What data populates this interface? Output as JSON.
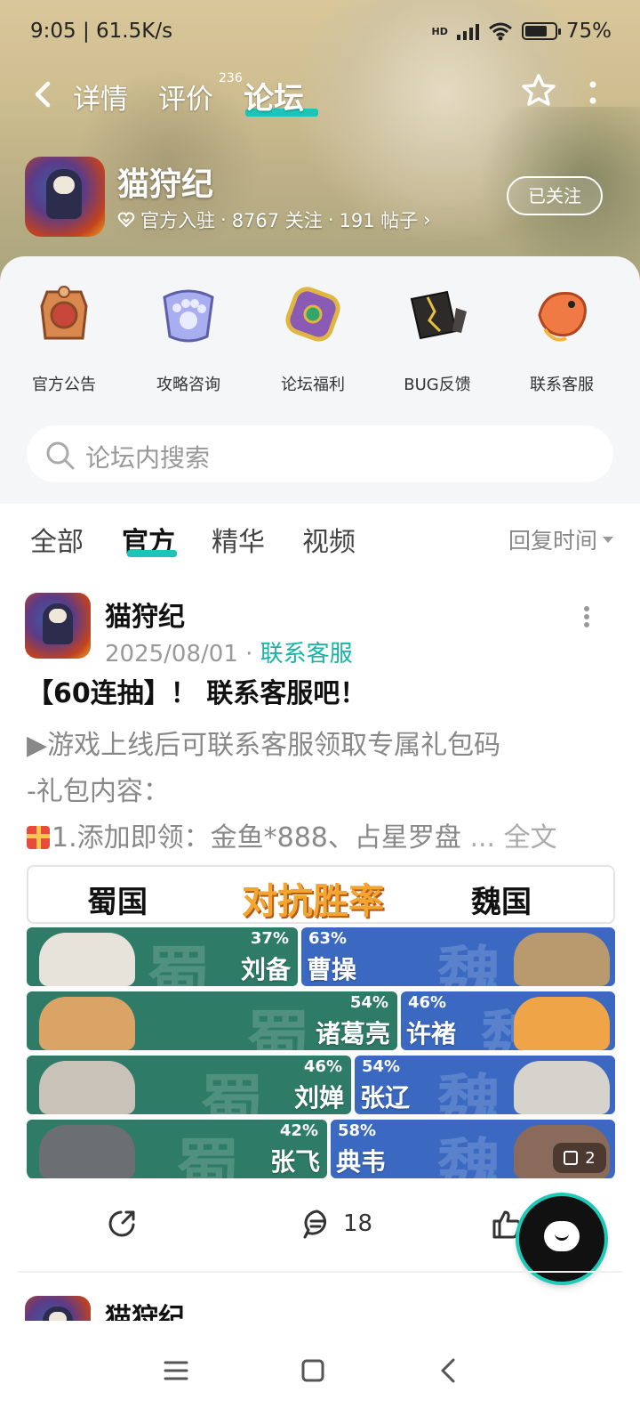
{
  "status_bar": {
    "time": "9:05",
    "net_speed": "61.5K/s",
    "battery": "75%",
    "battery_level": 0.75,
    "signal_label": "HD"
  },
  "nav": {
    "tabs": [
      {
        "label": "详情"
      },
      {
        "label": "评价",
        "badge": "236"
      },
      {
        "label": "论坛"
      }
    ]
  },
  "forum": {
    "name": "猫狩纪",
    "official": "官方入驻",
    "followers": "8767 关注",
    "posts": "191 帖子",
    "follow_button": "已关注"
  },
  "quick_links": [
    {
      "label": "官方公告",
      "icon": "announcement-icon",
      "color": "#c8683a"
    },
    {
      "label": "攻略咨询",
      "icon": "paw-guide-icon",
      "color": "#8d8fd8"
    },
    {
      "label": "论坛福利",
      "icon": "gift-badge-icon",
      "color": "#8a5ab5"
    },
    {
      "label": "BUG反馈",
      "icon": "cracked-stone-icon",
      "color": "#3a3030"
    },
    {
      "label": "联系客服",
      "icon": "koi-fish-icon",
      "color": "#e8663c"
    }
  ],
  "search": {
    "placeholder": "论坛内搜索"
  },
  "filters": {
    "tabs": [
      {
        "label": "全部"
      },
      {
        "label": "官方"
      },
      {
        "label": "精华"
      },
      {
        "label": "视频"
      }
    ],
    "sort": "回复时间"
  },
  "post": {
    "author": "猫狩纪",
    "date": "2025/08/01",
    "category": "联系客服",
    "title": "【60连抽】！ 联系客服吧！",
    "lines": [
      "▶游戏上线后可联系客服领取专属礼包码",
      "-礼包内容：",
      "1.添加即领：金鱼*888、占星罗盘"
    ],
    "ellipsis": "...",
    "full_text": "全文",
    "image": {
      "left_team": "蜀国",
      "center_title": "对抗胜率",
      "right_team": "魏国",
      "watermark_left": "蜀",
      "watermark_right": "魏",
      "matchups": [
        {
          "shu_name": "刘备",
          "shu_pct": "37%",
          "wei_name": "曹操",
          "wei_pct": "63%",
          "shu": 0.37
        },
        {
          "shu_name": "诸葛亮",
          "shu_pct": "54%",
          "wei_name": "许褚",
          "wei_pct": "46%",
          "shu": 0.54
        },
        {
          "shu_name": "刘婵",
          "shu_pct": "46%",
          "wei_name": "张辽",
          "wei_pct": "54%",
          "shu": 0.46
        },
        {
          "shu_name": "张飞",
          "shu_pct": "42%",
          "wei_name": "典韦",
          "wei_pct": "58%",
          "shu": 0.42
        }
      ],
      "count": "2"
    },
    "comments": "18"
  },
  "next_post": {
    "author": "猫狩纪"
  }
}
